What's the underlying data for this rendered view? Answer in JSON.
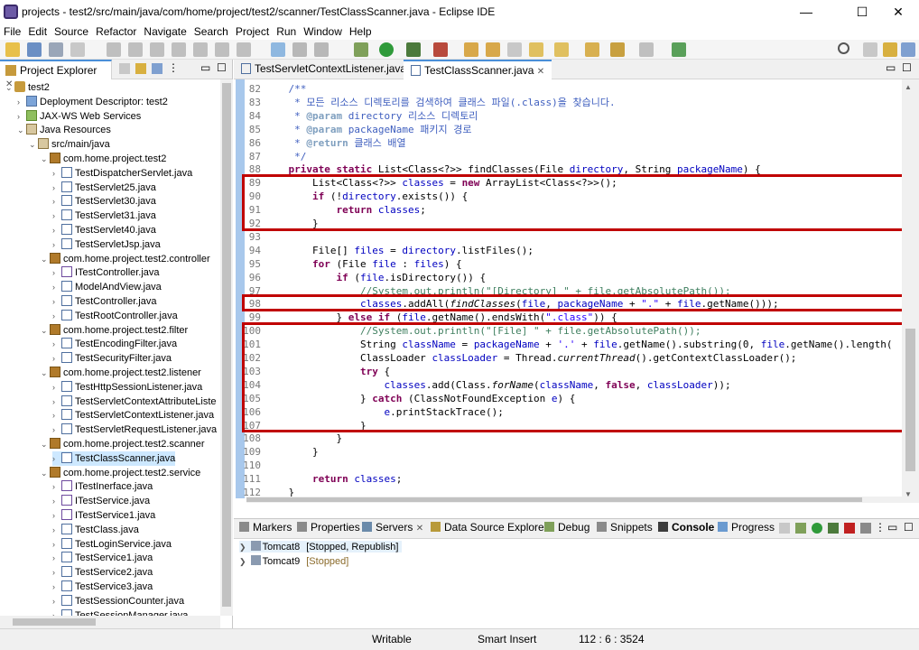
{
  "window": {
    "title": "projects - test2/src/main/java/com/home/project/test2/scanner/TestClassScanner.java - Eclipse IDE",
    "minimize": "—",
    "maximize": "☐",
    "close": "✕"
  },
  "menu": [
    "File",
    "Edit",
    "Source",
    "Refactor",
    "Navigate",
    "Search",
    "Project",
    "Run",
    "Window",
    "Help"
  ],
  "explorer": {
    "title": "Project Explorer",
    "tree": [
      {
        "d": 0,
        "t": "open",
        "icon": "proj",
        "label": "test2"
      },
      {
        "d": 1,
        "t": "closed",
        "icon": "dd",
        "label": "Deployment Descriptor: test2"
      },
      {
        "d": 1,
        "t": "closed",
        "icon": "ws",
        "label": "JAX-WS Web Services"
      },
      {
        "d": 1,
        "t": "open",
        "icon": "lib",
        "label": "Java Resources"
      },
      {
        "d": 2,
        "t": "open",
        "icon": "lib",
        "label": "src/main/java"
      },
      {
        "d": 3,
        "t": "open",
        "icon": "pkg",
        "label": "com.home.project.test2"
      },
      {
        "d": 4,
        "t": "closed",
        "icon": "file",
        "label": "TestDispatcherServlet.java"
      },
      {
        "d": 4,
        "t": "closed",
        "icon": "file",
        "label": "TestServlet25.java"
      },
      {
        "d": 4,
        "t": "closed",
        "icon": "file",
        "label": "TestServlet30.java"
      },
      {
        "d": 4,
        "t": "closed",
        "icon": "file",
        "label": "TestServlet31.java"
      },
      {
        "d": 4,
        "t": "closed",
        "icon": "file",
        "label": "TestServlet40.java"
      },
      {
        "d": 4,
        "t": "closed",
        "icon": "file",
        "label": "TestServletJsp.java"
      },
      {
        "d": 3,
        "t": "open",
        "icon": "pkg",
        "label": "com.home.project.test2.controller"
      },
      {
        "d": 4,
        "t": "closed",
        "icon": "if",
        "label": "ITestController.java"
      },
      {
        "d": 4,
        "t": "closed",
        "icon": "file",
        "label": "ModelAndView.java"
      },
      {
        "d": 4,
        "t": "closed",
        "icon": "file",
        "label": "TestController.java"
      },
      {
        "d": 4,
        "t": "closed",
        "icon": "file",
        "label": "TestRootController.java"
      },
      {
        "d": 3,
        "t": "open",
        "icon": "pkg",
        "label": "com.home.project.test2.filter"
      },
      {
        "d": 4,
        "t": "closed",
        "icon": "file",
        "label": "TestEncodingFilter.java"
      },
      {
        "d": 4,
        "t": "closed",
        "icon": "file",
        "label": "TestSecurityFilter.java"
      },
      {
        "d": 3,
        "t": "open",
        "icon": "pkg",
        "label": "com.home.project.test2.listener"
      },
      {
        "d": 4,
        "t": "closed",
        "icon": "file",
        "label": "TestHttpSessionListener.java"
      },
      {
        "d": 4,
        "t": "closed",
        "icon": "file",
        "label": "TestServletContextAttributeListe"
      },
      {
        "d": 4,
        "t": "closed",
        "icon": "file",
        "label": "TestServletContextListener.java"
      },
      {
        "d": 4,
        "t": "closed",
        "icon": "file",
        "label": "TestServletRequestListener.java"
      },
      {
        "d": 3,
        "t": "open",
        "icon": "pkg",
        "label": "com.home.project.test2.scanner"
      },
      {
        "d": 4,
        "t": "closed",
        "icon": "file",
        "label": "TestClassScanner.java",
        "sel": true
      },
      {
        "d": 3,
        "t": "open",
        "icon": "pkg",
        "label": "com.home.project.test2.service"
      },
      {
        "d": 4,
        "t": "closed",
        "icon": "if",
        "label": "ITestInerface.java"
      },
      {
        "d": 4,
        "t": "closed",
        "icon": "if",
        "label": "ITestService.java"
      },
      {
        "d": 4,
        "t": "closed",
        "icon": "if",
        "label": "ITestService1.java"
      },
      {
        "d": 4,
        "t": "closed",
        "icon": "file",
        "label": "TestClass.java"
      },
      {
        "d": 4,
        "t": "closed",
        "icon": "file",
        "label": "TestLoginService.java"
      },
      {
        "d": 4,
        "t": "closed",
        "icon": "file",
        "label": "TestService1.java"
      },
      {
        "d": 4,
        "t": "closed",
        "icon": "file",
        "label": "TestService2.java"
      },
      {
        "d": 4,
        "t": "closed",
        "icon": "file",
        "label": "TestService3.java"
      },
      {
        "d": 4,
        "t": "closed",
        "icon": "file",
        "label": "TestSessionCounter.java"
      },
      {
        "d": 4,
        "t": "closed",
        "icon": "file",
        "label": "TestSessionManager.java"
      }
    ]
  },
  "editor": {
    "tabs": [
      "TestServletContextListener.java",
      "TestClassScanner.java"
    ],
    "active_tab": 1,
    "lines": [
      {
        "n": "82",
        "s": [
          [
            "c",
            "    /**"
          ]
        ]
      },
      {
        "n": "83",
        "s": [
          [
            "c",
            "     * 모든 리소스 디렉토리를 검색하여 클래스 파일(.class)을 찾습니다."
          ]
        ]
      },
      {
        "n": "84",
        "s": [
          [
            "c",
            "     * "
          ],
          [
            "ct",
            "@param"
          ],
          [
            "c",
            " "
          ],
          [
            "cp",
            "directory"
          ],
          [
            "c",
            " 리소스 디렉토리"
          ]
        ]
      },
      {
        "n": "85",
        "s": [
          [
            "c",
            "     * "
          ],
          [
            "ct",
            "@param"
          ],
          [
            "c",
            " "
          ],
          [
            "cp",
            "packageName"
          ],
          [
            "c",
            " 패키지 경로"
          ]
        ]
      },
      {
        "n": "86",
        "s": [
          [
            "c",
            "     * "
          ],
          [
            "ct",
            "@return"
          ],
          [
            "c",
            " 클래스 배열"
          ]
        ]
      },
      {
        "n": "87",
        "s": [
          [
            "c",
            "     */"
          ]
        ]
      },
      {
        "n": "88",
        "s": [
          [
            "t",
            "    "
          ],
          [
            "k",
            "private"
          ],
          [
            "t",
            " "
          ],
          [
            "k",
            "static"
          ],
          [
            "t",
            " List<Class<?>> findClasses(File "
          ],
          [
            "v",
            "directory"
          ],
          [
            "t",
            ", String "
          ],
          [
            "v",
            "packageName"
          ],
          [
            "t",
            ") {"
          ]
        ]
      },
      {
        "n": "89",
        "s": [
          [
            "t",
            "        List<Class<?>> "
          ],
          [
            "v",
            "classes"
          ],
          [
            "t",
            " = "
          ],
          [
            "k",
            "new"
          ],
          [
            "t",
            " ArrayList<Class<?>>();"
          ]
        ]
      },
      {
        "n": "90",
        "s": [
          [
            "t",
            "        "
          ],
          [
            "k",
            "if"
          ],
          [
            "t",
            " (!"
          ],
          [
            "v",
            "directory"
          ],
          [
            "t",
            ".exists()) {"
          ]
        ]
      },
      {
        "n": "91",
        "s": [
          [
            "t",
            "            "
          ],
          [
            "k",
            "return"
          ],
          [
            "t",
            " "
          ],
          [
            "v",
            "classes"
          ],
          [
            "t",
            ";"
          ]
        ]
      },
      {
        "n": "92",
        "s": [
          [
            "t",
            "        }"
          ]
        ]
      },
      {
        "n": "93",
        "s": [
          [
            "t",
            ""
          ]
        ]
      },
      {
        "n": "94",
        "s": [
          [
            "t",
            "        File[] "
          ],
          [
            "v",
            "files"
          ],
          [
            "t",
            " = "
          ],
          [
            "v",
            "directory"
          ],
          [
            "t",
            ".listFiles();"
          ]
        ]
      },
      {
        "n": "95",
        "s": [
          [
            "t",
            "        "
          ],
          [
            "k",
            "for"
          ],
          [
            "t",
            " (File "
          ],
          [
            "v",
            "file"
          ],
          [
            "t",
            " : "
          ],
          [
            "v",
            "files"
          ],
          [
            "t",
            ") {"
          ]
        ]
      },
      {
        "n": "96",
        "s": [
          [
            "t",
            "            "
          ],
          [
            "k",
            "if"
          ],
          [
            "t",
            " ("
          ],
          [
            "v",
            "file"
          ],
          [
            "t",
            ".isDirectory()) {"
          ]
        ]
      },
      {
        "n": "97",
        "s": [
          [
            "g",
            "                //System.out.println(\"[Directory] \" + file.getAbsolutePath());"
          ]
        ]
      },
      {
        "n": "98",
        "s": [
          [
            "t",
            "                "
          ],
          [
            "v",
            "classes"
          ],
          [
            "t",
            ".addAll("
          ],
          [
            "i",
            "findClasses"
          ],
          [
            "t",
            "("
          ],
          [
            "v",
            "file"
          ],
          [
            "t",
            ", "
          ],
          [
            "v",
            "packageName"
          ],
          [
            "t",
            " + "
          ],
          [
            "s",
            "\".\""
          ],
          [
            "t",
            " + "
          ],
          [
            "v",
            "file"
          ],
          [
            "t",
            ".getName()));"
          ]
        ]
      },
      {
        "n": "99",
        "s": [
          [
            "t",
            "            } "
          ],
          [
            "k",
            "else"
          ],
          [
            "t",
            " "
          ],
          [
            "k",
            "if"
          ],
          [
            "t",
            " ("
          ],
          [
            "v",
            "file"
          ],
          [
            "t",
            ".getName().endsWith("
          ],
          [
            "s",
            "\".class\""
          ],
          [
            "t",
            ")) {"
          ]
        ]
      },
      {
        "n": "100",
        "s": [
          [
            "g",
            "                //System.out.println(\"[File] \" + file.getAbsolutePath());"
          ]
        ]
      },
      {
        "n": "101",
        "s": [
          [
            "t",
            "                String "
          ],
          [
            "v",
            "className"
          ],
          [
            "t",
            " = "
          ],
          [
            "v",
            "packageName"
          ],
          [
            "t",
            " + "
          ],
          [
            "s",
            "'.'"
          ],
          [
            "t",
            " + "
          ],
          [
            "v",
            "file"
          ],
          [
            "t",
            ".getName().substring(0, "
          ],
          [
            "v",
            "file"
          ],
          [
            "t",
            ".getName().length("
          ]
        ]
      },
      {
        "n": "102",
        "s": [
          [
            "t",
            "                ClassLoader "
          ],
          [
            "v",
            "classLoader"
          ],
          [
            "t",
            " = Thread."
          ],
          [
            "i",
            "currentThread"
          ],
          [
            "t",
            "().getContextClassLoader();"
          ]
        ]
      },
      {
        "n": "103",
        "s": [
          [
            "t",
            "                "
          ],
          [
            "k",
            "try"
          ],
          [
            "t",
            " {"
          ]
        ]
      },
      {
        "n": "104",
        "s": [
          [
            "t",
            "                    "
          ],
          [
            "v",
            "classes"
          ],
          [
            "t",
            ".add(Class."
          ],
          [
            "i",
            "forName"
          ],
          [
            "t",
            "("
          ],
          [
            "v",
            "className"
          ],
          [
            "t",
            ", "
          ],
          [
            "k",
            "false"
          ],
          [
            "t",
            ", "
          ],
          [
            "v",
            "classLoader"
          ],
          [
            "t",
            "));"
          ]
        ]
      },
      {
        "n": "105",
        "s": [
          [
            "t",
            "                } "
          ],
          [
            "k",
            "catch"
          ],
          [
            "t",
            " (ClassNotFoundException "
          ],
          [
            "v",
            "e"
          ],
          [
            "t",
            ") {"
          ]
        ]
      },
      {
        "n": "106",
        "s": [
          [
            "t",
            "                    "
          ],
          [
            "v",
            "e"
          ],
          [
            "t",
            ".printStackTrace();"
          ]
        ]
      },
      {
        "n": "107",
        "s": [
          [
            "t",
            "                }"
          ]
        ]
      },
      {
        "n": "108",
        "s": [
          [
            "t",
            "            }"
          ]
        ]
      },
      {
        "n": "109",
        "s": [
          [
            "t",
            "        }"
          ]
        ]
      },
      {
        "n": "110",
        "s": [
          [
            "t",
            ""
          ]
        ]
      },
      {
        "n": "111",
        "s": [
          [
            "t",
            "        "
          ],
          [
            "k",
            "return"
          ],
          [
            "t",
            " "
          ],
          [
            "v",
            "classes"
          ],
          [
            "t",
            ";"
          ]
        ]
      },
      {
        "n": "112",
        "s": [
          [
            "t",
            "    }"
          ]
        ]
      }
    ]
  },
  "bottom": {
    "tabs": [
      "Markers",
      "Properties",
      "Servers",
      "Data Source Explorer",
      "Debug",
      "Snippets",
      "Console",
      "Progress"
    ],
    "servers": [
      {
        "name": "Tomcat8",
        "state": "[Stopped, Republish]"
      },
      {
        "name": "Tomcat9",
        "state": "[Stopped]"
      }
    ]
  },
  "status": {
    "mode": "Writable",
    "insert": "Smart Insert",
    "position": "112 : 6 : 3524"
  },
  "colors": {
    "keyword": "#7f0055",
    "comment": "#3f5fbf",
    "javadoc_tag": "#7f9fbf",
    "field": "#0000c0",
    "string": "#2a00ff",
    "line_comment": "#3f7f5f",
    "highlight": "#c00000"
  }
}
